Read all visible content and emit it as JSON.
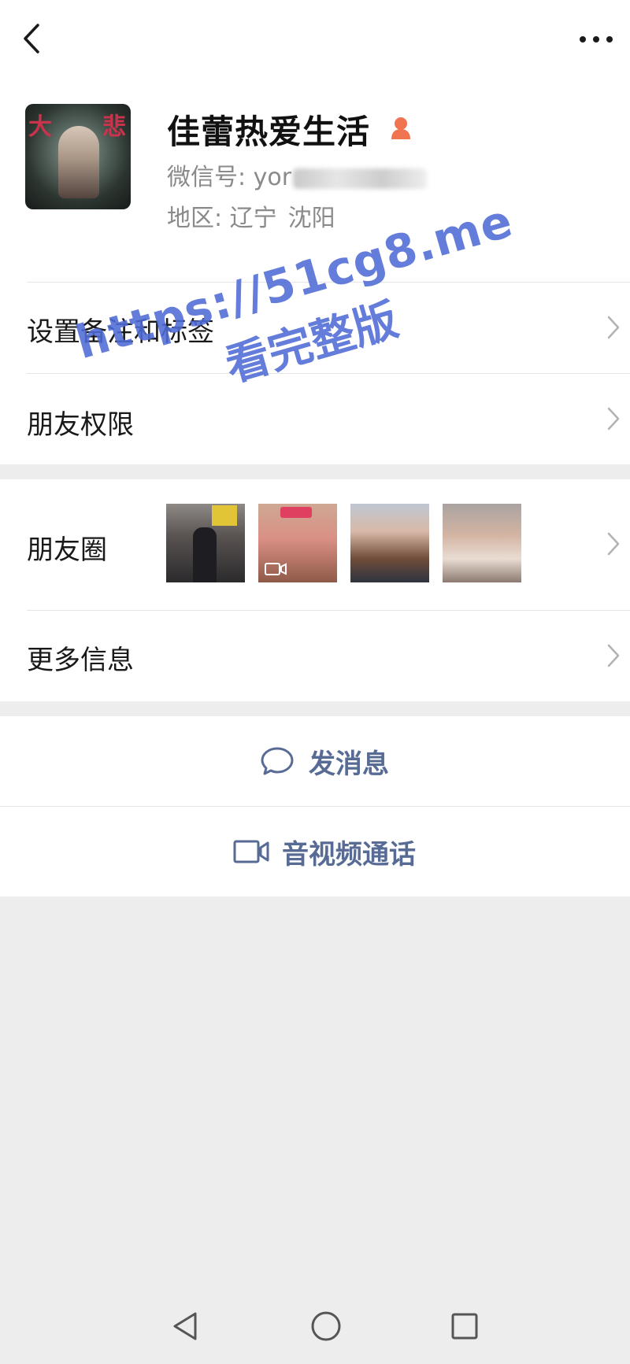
{
  "header": {
    "back_icon": "chevron-left-icon",
    "more_icon": "more-dots-icon"
  },
  "profile": {
    "name": "佳蕾热爱生活",
    "gender_icon": "female-icon",
    "gender_color": "#f0744f",
    "wechat_label": "微信号: ",
    "wechat_id_visible": "yor",
    "region_label": "地区: ",
    "region_province": "辽宁",
    "region_city": "沈阳"
  },
  "menu": {
    "remark_tags": "设置备注和标签",
    "friend_permissions": "朋友权限",
    "moments": "朋友圈",
    "more_info": "更多信息"
  },
  "moments_thumbs": [
    {
      "kind": "photo",
      "desc_icon": "photo-thumbnail"
    },
    {
      "kind": "video",
      "desc_icon": "video-thumbnail"
    },
    {
      "kind": "photo",
      "desc_icon": "photo-thumbnail"
    },
    {
      "kind": "photo",
      "desc_icon": "photo-thumbnail"
    }
  ],
  "actions": {
    "send_message": "发消息",
    "send_message_icon": "chat-bubble-icon",
    "video_call": "音视频通话",
    "video_call_icon": "video-camera-icon",
    "accent_color": "#576b95"
  },
  "watermark": {
    "url": "https://51cg8.me",
    "tag": "看完整版",
    "color": "#4f6bd6"
  },
  "system_nav": {
    "back_icon": "nav-back-triangle-icon",
    "home_icon": "nav-home-circle-icon",
    "recents_icon": "nav-recents-square-icon"
  }
}
